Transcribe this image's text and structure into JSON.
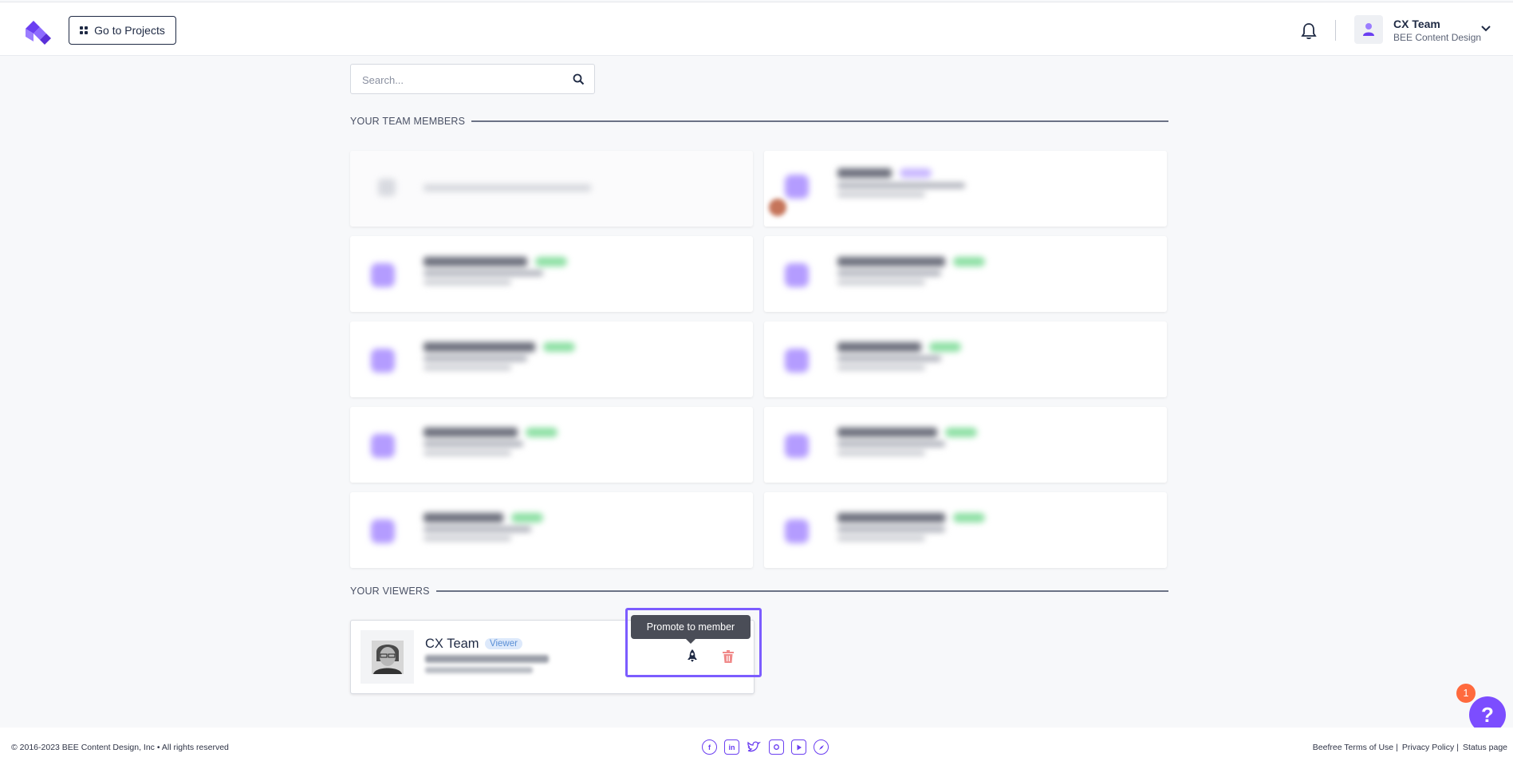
{
  "header": {
    "logo": "bee-logo",
    "go_projects_label": "Go to Projects",
    "user_name": "CX Team",
    "user_team": "BEE Content Design"
  },
  "search": {
    "placeholder": "Search..."
  },
  "sections": {
    "team_members": "YOUR TEAM MEMBERS",
    "viewers": "YOUR VIEWERS"
  },
  "viewer": {
    "name": "CX Team",
    "role": "Viewer",
    "tooltip": "Promote to member"
  },
  "help": {
    "label": "?",
    "badge": "1"
  },
  "footer": {
    "copyright": "© 2016-2023 BEE Content Design, Inc • All rights reserved",
    "links": [
      "Beefree Terms of Use",
      "Privacy Policy",
      "Status page"
    ],
    "socials": [
      "facebook-icon",
      "linkedin-icon",
      "twitter-icon",
      "instagram-icon",
      "youtube-icon",
      "compass-icon"
    ]
  },
  "colors": {
    "accent": "#7c4dff",
    "highlight": "#7c5cff",
    "badge": "#ff6a3d",
    "delete": "#f08a8a"
  }
}
